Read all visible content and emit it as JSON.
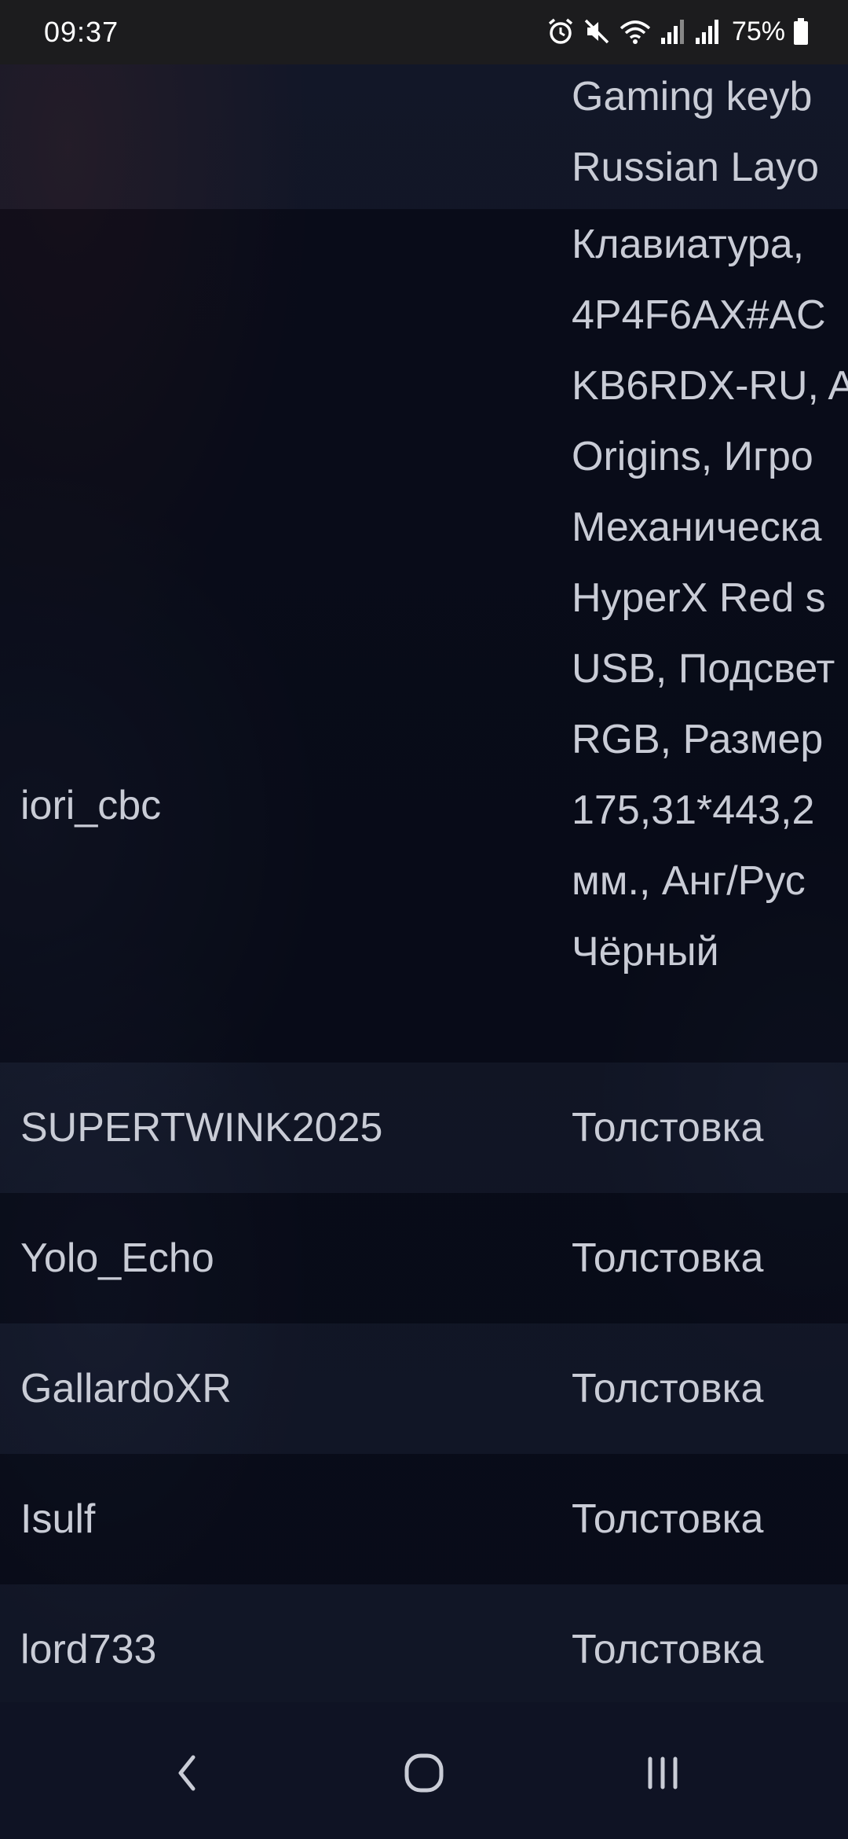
{
  "status_bar": {
    "time": "09:37",
    "battery": "75%",
    "icons": [
      "alarm-icon",
      "mute-icon",
      "wifi-icon",
      "signal-icon",
      "signal-icon",
      "battery-icon"
    ]
  },
  "table": {
    "rows": [
      {
        "user": "",
        "item_lines": [
          "Gaming keyb",
          "Russian Layo"
        ]
      },
      {
        "user": "iori_cbc",
        "item_lines": [
          "Клавиатура,",
          "4P4F6AX#AC",
          "KB6RDX-RU, A",
          "Origins, Игро",
          "Механическа",
          "HyperX Red s",
          "USB, Подсвет",
          "RGB, Размер",
          "175,31*443,2",
          "мм., Анг/Рус",
          "Чёрный"
        ]
      },
      {
        "user": "SUPERTWINK2025",
        "item_lines": [
          "Толстовка"
        ]
      },
      {
        "user": "Yolo_Echo",
        "item_lines": [
          "Толстовка"
        ]
      },
      {
        "user": "GallardoXR",
        "item_lines": [
          "Толстовка"
        ]
      },
      {
        "user": "Isulf",
        "item_lines": [
          "Толстовка"
        ]
      },
      {
        "user": "lord733",
        "item_lines": [
          "Толстовка"
        ]
      }
    ]
  },
  "nav_bar": {
    "icons": [
      "back-icon",
      "home-icon",
      "recent-apps-icon"
    ]
  }
}
